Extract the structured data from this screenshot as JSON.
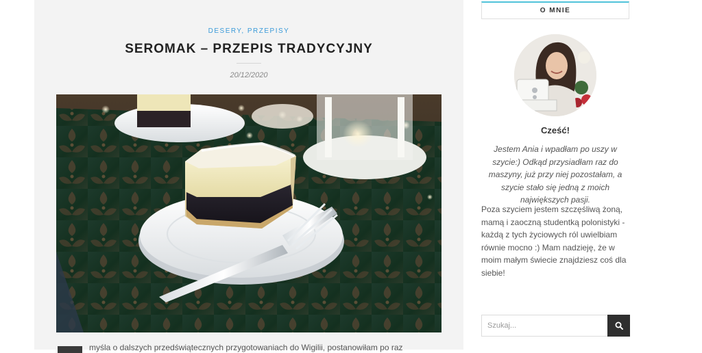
{
  "post": {
    "categories": [
      "DESERY",
      "PRZEPISY"
    ],
    "category_separator": ", ",
    "title": "SEROMAK – PRZEPIS TRADYCYJNY",
    "date": "20/12/2020",
    "excerpt": "myśla o dalszych przedświątecznych przygotowaniach do Wigilii, postanowiłam po raz"
  },
  "sidebar": {
    "widget_title": "O MNIE",
    "greeting": "Cześć!",
    "bio_italic": "Jestem Ania i wpadłam po uszy w szycie:) Odkąd przysiadłam raz do maszyny, już przy niej pozostałam, a szycie stało się jedną z moich największych pasji.",
    "bio_text": "Poza szyciem jestem szczęśliwą żoną, mamą i zaoczną studentką polonistyki - każdą z tych życiowych ról uwielbiam równie mocno :) Mam nadzieję, że w moim małym świecie znajdziesz coś dla siebie!",
    "search_placeholder": "Szukaj...",
    "search_icon": "search-icon"
  },
  "colors": {
    "accent": "#3a9ad9",
    "widget_border": "#4fc3d9",
    "card_bg": "#f3f3f3",
    "button_bg": "#2f2f2f"
  }
}
